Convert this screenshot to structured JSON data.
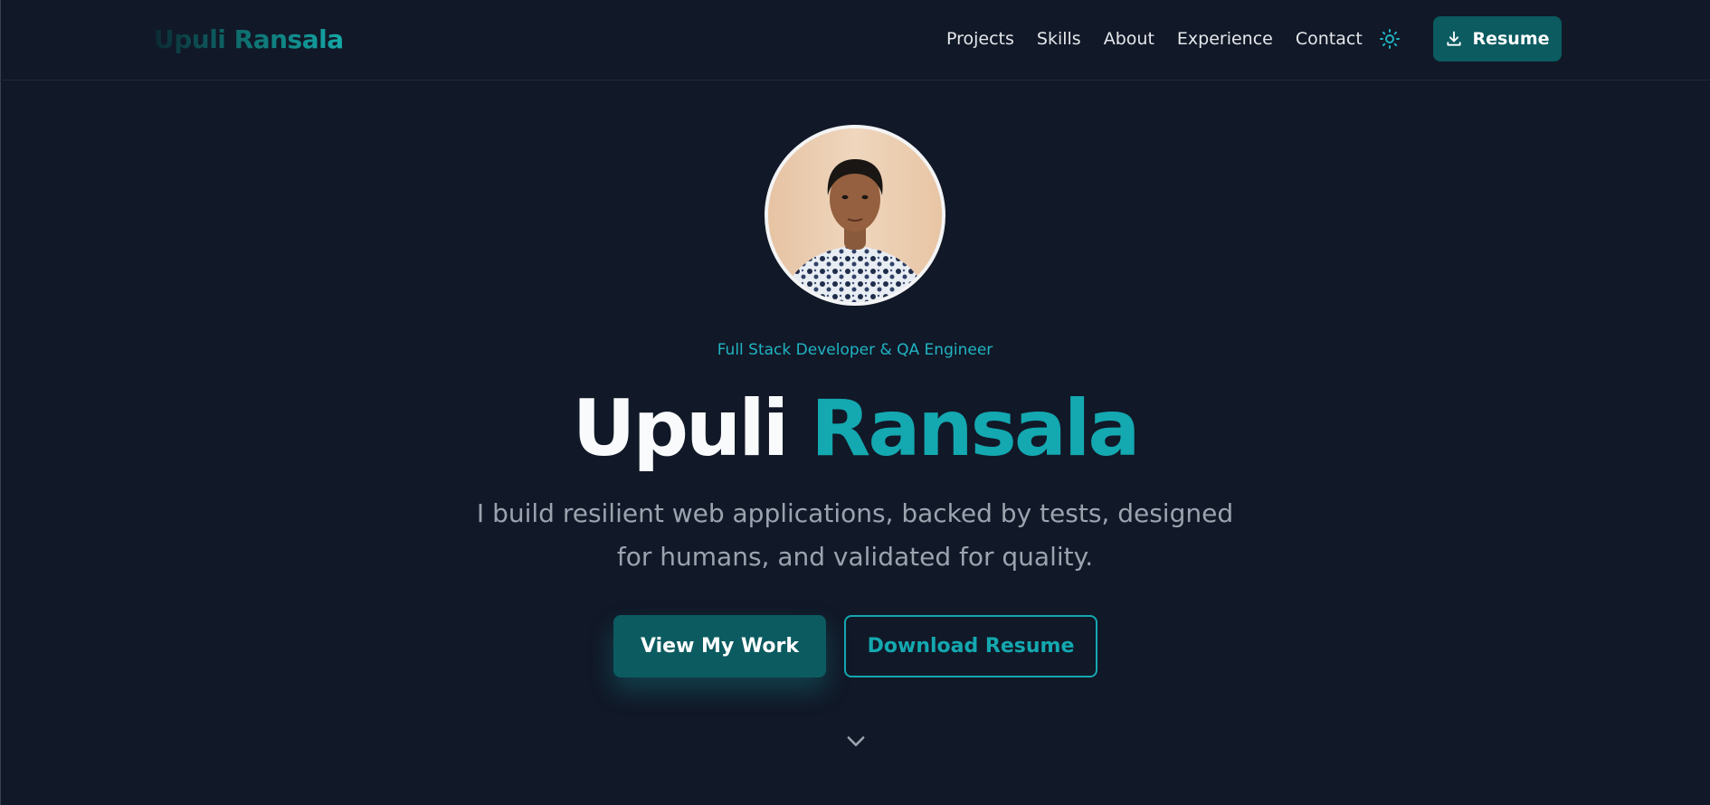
{
  "brand": {
    "name": "Upuli Ransala"
  },
  "nav": {
    "links": [
      "Projects",
      "Skills",
      "About",
      "Experience",
      "Contact"
    ],
    "theme_toggle_icon": "sun-icon",
    "resume_label": "Resume",
    "resume_icon": "download-icon"
  },
  "hero": {
    "avatar_alt": "profile-photo",
    "tagline": "Full Stack Developer & QA Engineer",
    "first_name": "Upuli",
    "last_name": "Ransala",
    "subtitle": "I build resilient web applications, backed by tests, designed for humans, and validated for quality.",
    "primary_cta": "View My Work",
    "secondary_cta": "Download Resume",
    "scroll_icon": "chevron-down-icon"
  },
  "colors": {
    "background": "#111827",
    "accent": "#14a8b0",
    "button_fill": "#0b5b60",
    "muted_text": "#9ca3af"
  }
}
